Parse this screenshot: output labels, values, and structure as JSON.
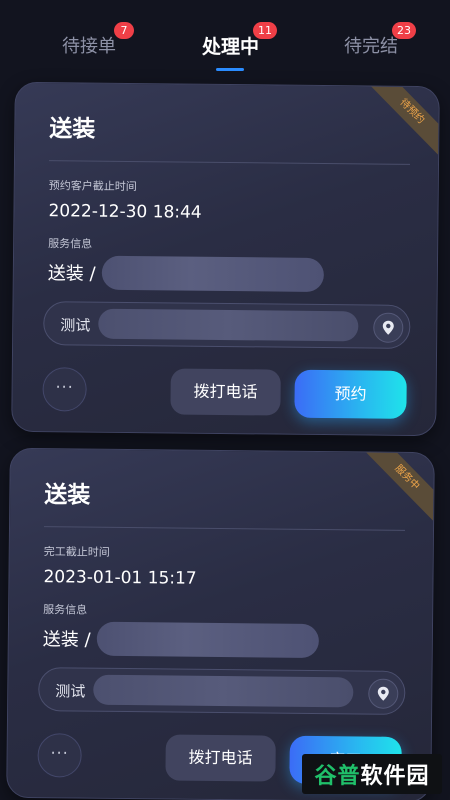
{
  "tabs": [
    {
      "label": "待接单",
      "badge": "7"
    },
    {
      "label": "处理中",
      "badge": "11"
    },
    {
      "label": "待完结",
      "badge": "23"
    }
  ],
  "cards": [
    {
      "status": "待预约",
      "title": "送装",
      "deadline_label": "预约客户截止时间",
      "deadline": "2022-12-30 18:44",
      "service_label": "服务信息",
      "service_prefix": "送装 /",
      "address_label": "测试",
      "more_label": "···",
      "call_label": "拨打电话",
      "primary_label": "预约"
    },
    {
      "status": "服务中",
      "title": "送装",
      "deadline_label": "完工截止时间",
      "deadline": "2023-01-01 15:17",
      "service_label": "服务信息",
      "service_prefix": "送装 /",
      "address_label": "测试",
      "more_label": "···",
      "call_label": "拨打电话",
      "primary_label": "完工"
    }
  ],
  "watermark": {
    "part1": "谷普",
    "part2": "软件园"
  },
  "colors": {
    "background": "#12141f",
    "accent": "#2b8cff",
    "badge": "#ef3f47",
    "ribbon_text": "#f0a64a"
  },
  "icons": [
    "location-pin-icon",
    "more-dots-icon"
  ]
}
